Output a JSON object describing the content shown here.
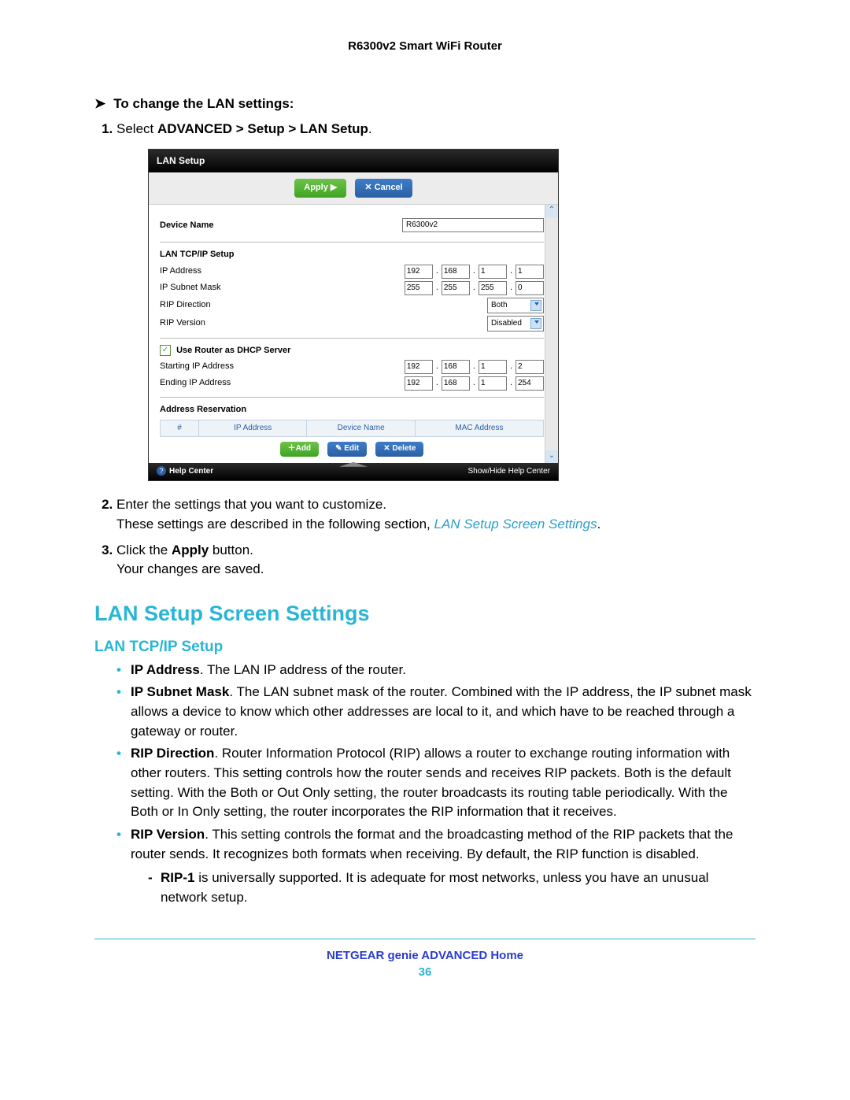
{
  "header": {
    "title": "R6300v2 Smart WiFi Router"
  },
  "task": {
    "heading": "To change the LAN settings:",
    "step1_pre": "Select ",
    "step1_bold": "ADVANCED > Setup > LAN Setup",
    "step1_post": ".",
    "step2": "Enter the settings that you want to customize.",
    "step2_desc_pre": "These settings are described in the following section, ",
    "step2_link": "LAN Setup Screen Settings",
    "step2_desc_post": ".",
    "step3_pre": "Click the ",
    "step3_bold": "Apply",
    "step3_post": " button.",
    "step3_result": "Your changes are saved."
  },
  "screenshot": {
    "title": "LAN Setup",
    "apply": "Apply ▶",
    "cancel": "✕ Cancel",
    "device_name_label": "Device Name",
    "device_name_value": "R6300v2",
    "section_tcpip": "LAN TCP/IP Setup",
    "ip_label": "IP Address",
    "ip": [
      "192",
      "168",
      "1",
      "1"
    ],
    "mask_label": "IP Subnet Mask",
    "mask": [
      "255",
      "255",
      "255",
      "0"
    ],
    "rip_dir_label": "RIP Direction",
    "rip_dir": "Both",
    "rip_ver_label": "RIP Version",
    "rip_ver": "Disabled",
    "dhcp_label": "Use Router as DHCP Server",
    "start_label": "Starting IP Address",
    "start": [
      "192",
      "168",
      "1",
      "2"
    ],
    "end_label": "Ending IP Address",
    "end": [
      "192",
      "168",
      "1",
      "254"
    ],
    "res_section": "Address Reservation",
    "res_cols": {
      "num": "#",
      "ip": "IP Address",
      "dev": "Device Name",
      "mac": "MAC Address"
    },
    "add": "＋Add",
    "edit": "✎ Edit",
    "delete": "✕ Delete",
    "help": "Help Center",
    "showhide": "Show/Hide Help Center"
  },
  "section": {
    "h2": "LAN Setup Screen Settings",
    "h3": "LAN TCP/IP Setup"
  },
  "bullets": {
    "ip_b": "IP Address",
    "ip_t": ". The LAN IP address of the router.",
    "mask_b": "IP Subnet Mask",
    "mask_t": ". The LAN subnet mask of the router. Combined with the IP address, the IP subnet mask allows a device to know which other addresses are local to it, and which have to be reached through a gateway or router.",
    "dir_b": "RIP Direction",
    "dir_t": ". Router Information Protocol (RIP) allows a router to exchange routing information with other routers. This setting controls how the router sends and receives RIP packets. Both is the default setting. With the Both or Out Only setting, the router broadcasts its routing table periodically. With the Both or In Only setting, the router incorporates the RIP information that it receives.",
    "ver_b": "RIP Version",
    "ver_t": ". This setting controls the format and the broadcasting method of the RIP packets that the router sends. It recognizes both formats when receiving. By default, the RIP function is disabled.",
    "rip1_b": "RIP-1",
    "rip1_t": " is universally supported. It is adequate for most networks, unless you have an unusual network setup."
  },
  "footer": {
    "text": "NETGEAR genie ADVANCED Home",
    "page": "36"
  }
}
